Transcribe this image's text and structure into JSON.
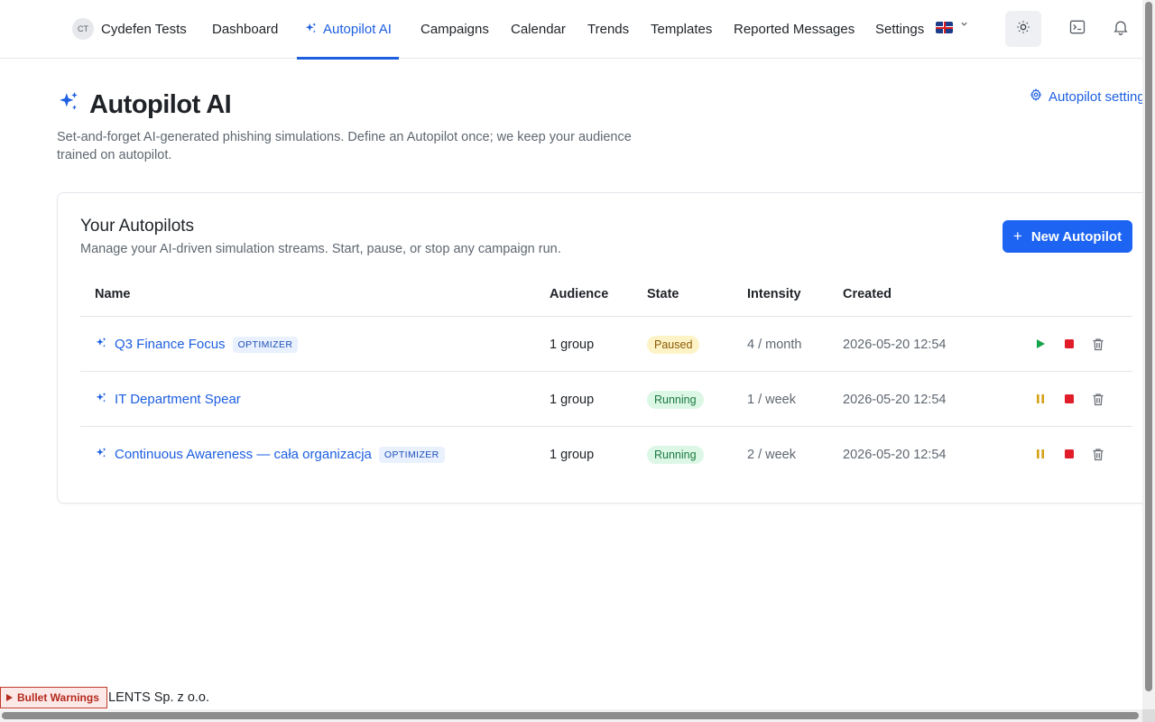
{
  "org": {
    "initials": "CT",
    "name": "Cydefen Tests"
  },
  "nav": {
    "items": [
      {
        "label": "Dashboard"
      },
      {
        "label": "Autopilot AI",
        "active": true
      },
      {
        "label": "Campaigns"
      },
      {
        "label": "Calendar"
      },
      {
        "label": "Trends"
      },
      {
        "label": "Templates"
      },
      {
        "label": "Reported Messages"
      },
      {
        "label": "Settings"
      }
    ],
    "language": "en-GB",
    "icons": [
      "theme-toggle-icon",
      "terminal-icon",
      "bell-icon"
    ]
  },
  "page": {
    "title": "Autopilot AI",
    "description": "Set-and-forget AI-generated phishing simulations. Define an Autopilot once; we keep your audience trained on autopilot.",
    "settings_link": "Autopilot settings"
  },
  "card": {
    "title": "Your Autopilots",
    "description": "Manage your AI-driven simulation streams. Start, pause, or stop any campaign run.",
    "new_button": "New Autopilot"
  },
  "table": {
    "headers": {
      "name": "Name",
      "audience": "Audience",
      "state": "State",
      "intensity": "Intensity",
      "created": "Created"
    },
    "rows": [
      {
        "name": "Q3 Finance Focus",
        "badge": "OPTIMIZER",
        "audience": "1 group",
        "state": "Paused",
        "intensity": "4 / month",
        "created": "2026-05-20 12:54"
      },
      {
        "name": "IT Department Spear",
        "badge": "",
        "audience": "1 group",
        "state": "Running",
        "intensity": "1 / week",
        "created": "2026-05-20 12:54"
      },
      {
        "name": "Continuous Awareness — cała organizacja",
        "badge": "OPTIMIZER",
        "audience": "1 group",
        "state": "Running",
        "intensity": "2 / week",
        "created": "2026-05-20 12:54"
      }
    ]
  },
  "footer": {
    "text": "LENTS Sp. z o.o."
  },
  "debug": {
    "bullet_warnings": "Bullet Warnings"
  },
  "colors": {
    "accent": "#1d64f2",
    "paused": "#fdf3c7",
    "running": "#dcf7e6",
    "stop": "#e11d2a",
    "play": "#16a34a",
    "pause": "#d4a015"
  }
}
